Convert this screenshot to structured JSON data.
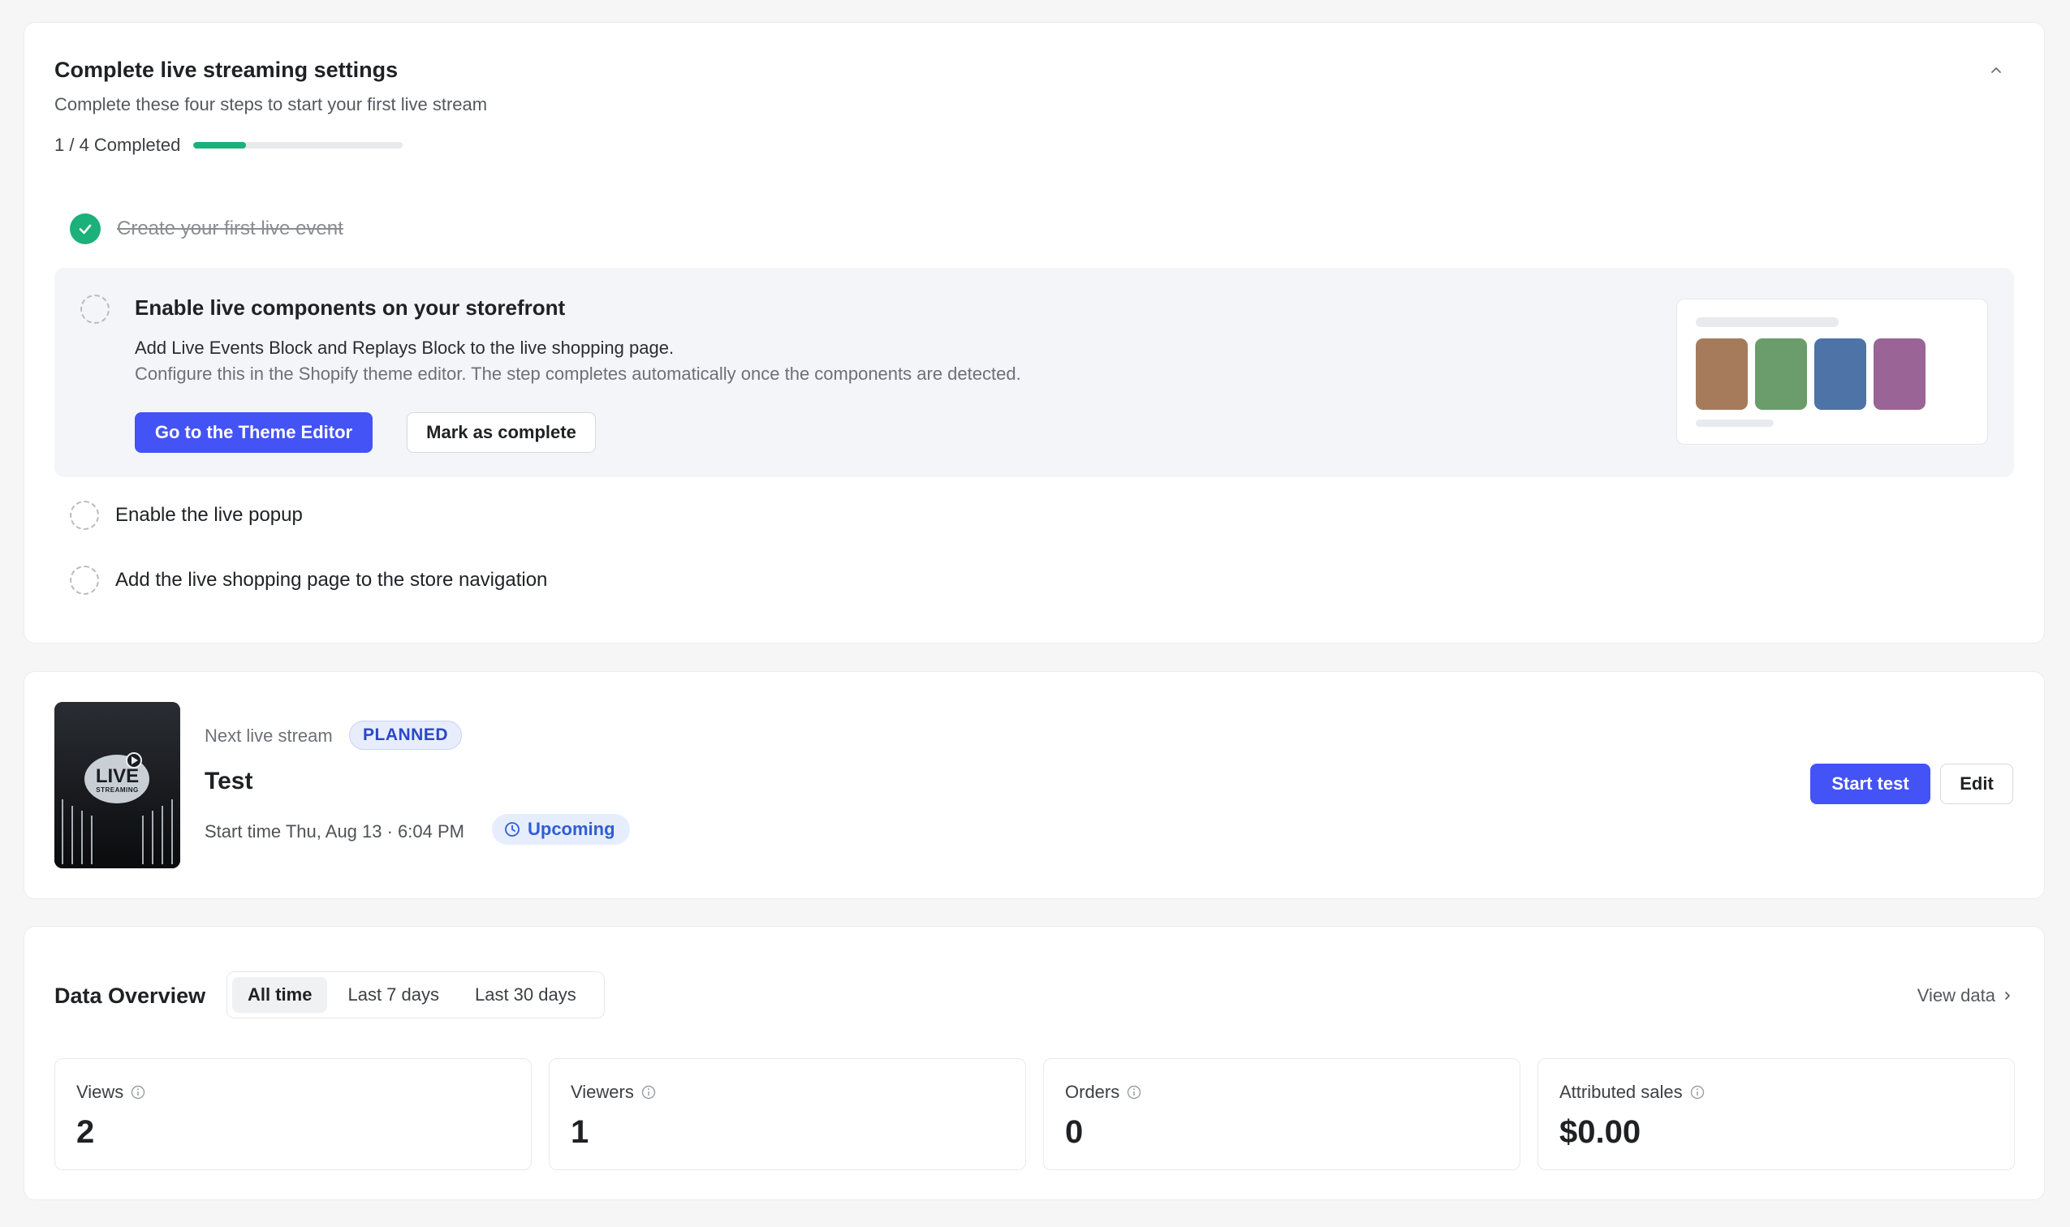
{
  "setup": {
    "title": "Complete live streaming settings",
    "subtitle": "Complete these four steps to start your first live stream",
    "progress_text": "1 / 4 Completed",
    "progress_fraction": 0.25,
    "steps": [
      {
        "label": "Create your first live event",
        "completed": true
      },
      {
        "label": "Enable live components on your storefront",
        "completed": false,
        "description": "Add Live Events Block and Replays Block to the live shopping page.",
        "hint": "Configure this in the Shopify theme editor. The step completes automatically once the components are detected.",
        "primary_button": "Go to the Theme Editor",
        "secondary_button": "Mark as complete"
      },
      {
        "label": "Enable the live popup",
        "completed": false
      },
      {
        "label": "Add the live shopping page to the store navigation",
        "completed": false
      }
    ],
    "preview_tile_colors": [
      "#a57b5c",
      "#6b9c6b",
      "#4e73a6",
      "#9a6496"
    ]
  },
  "stream": {
    "label": "Next live stream",
    "status_badge": "PLANNED",
    "title": "Test",
    "start_time": "Start time Thu, Aug 13 · 6:04 PM",
    "timing_badge": "Upcoming",
    "thumbnail_text_top": "LIVE",
    "thumbnail_text_bottom": "STREAMING",
    "start_button": "Start test",
    "edit_button": "Edit"
  },
  "overview": {
    "title": "Data Overview",
    "ranges": [
      "All time",
      "Last 7 days",
      "Last 30 days"
    ],
    "active_range": "All time",
    "view_data": "View data",
    "metrics": [
      {
        "label": "Views",
        "value": "2"
      },
      {
        "label": "Viewers",
        "value": "1"
      },
      {
        "label": "Orders",
        "value": "0"
      },
      {
        "label": "Attributed sales",
        "value": "$0.00"
      }
    ]
  },
  "colors": {
    "accent": "#4353f5",
    "success": "#1cb07a",
    "badge_blue": "#2a48c8"
  }
}
